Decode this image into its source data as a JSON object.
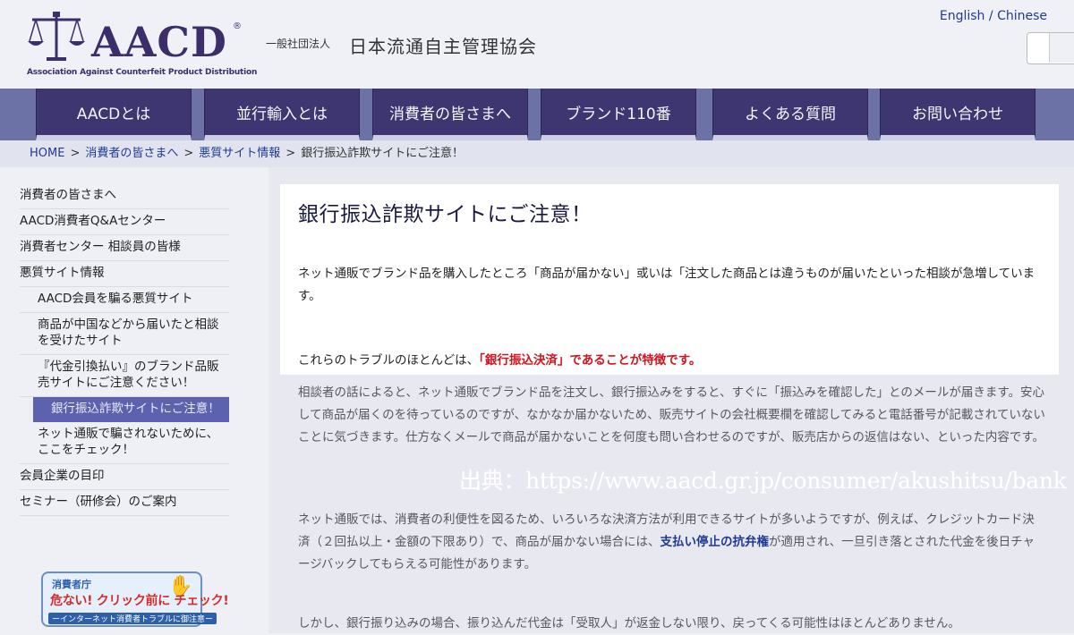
{
  "header": {
    "logo_text": "AACD",
    "logo_reg": "®",
    "logo_subtitle": "Association Against Counterfeit Product Distribution",
    "org_prefix": "一般社団法人",
    "org_name": "日本流通自主管理協会",
    "lang_english": "English",
    "lang_sep": "/",
    "lang_chinese": "Chinese",
    "search_placeholder": ""
  },
  "nav": {
    "items": [
      {
        "label": "AACDとは"
      },
      {
        "label": "並行輸入とは"
      },
      {
        "label": "消費者の皆さまへ"
      },
      {
        "label": "ブランド110番"
      },
      {
        "label": "よくある質問"
      },
      {
        "label": "お問い合わせ"
      }
    ]
  },
  "breadcrumb": {
    "home": "HOME",
    "arrow": ">",
    "level1": "消費者の皆さまへ",
    "level2": "悪質サイト情報",
    "current": "銀行振込詐欺サイトにご注意！"
  },
  "sidebar": {
    "items": [
      {
        "label": "消費者の皆さまへ"
      },
      {
        "label": "AACD消費者Q&Aセンター"
      },
      {
        "label": "消費者センター 相談員の皆様"
      },
      {
        "label": "悪質サイト情報"
      },
      {
        "label": "AACD会員を騙る悪質サイト"
      },
      {
        "label": "商品が中国などから届いたと相談を受けたサイト"
      },
      {
        "label": "『代金引換払い』のブランド品販売サイトにご注意ください！"
      },
      {
        "label": "銀行振込詐欺サイトにご注意！"
      },
      {
        "label": "ネット通販で騙されないために、ここをチェック！"
      },
      {
        "label": "会員企業の目印"
      },
      {
        "label": "セミナー（研修会）のご案内"
      }
    ],
    "banner": {
      "line1": "消費者庁",
      "line2": "危ない! クリック前に チェック!",
      "line3": "ーインターネット消費者トラブルに御注意ー"
    }
  },
  "main": {
    "title": "銀行振込詐欺サイトにご注意！",
    "intro": "ネット通販でブランド品を購入したところ「商品が届かない」或いは「注文した商品とは違うものが届いたといった相談が急増しています。",
    "feature_prefix": "これらのトラブルのほとんどは、",
    "feature_red": "「銀行振込決済」であることが特徴です。",
    "p1": "相談者の話によると、ネット通販でブランド品を注文し、銀行振込みをすると、すぐに「振込みを確認した」とのメールが届きます。安心して商品が届くのを待っているのですが、なかなか届かないため、販売サイトの会社概要欄を確認してみると電話番号が記載されていないことに気づきます。仕方なくメールで商品が届かないことを何度も問い合わせるのですが、販売店からの返信はない、といった内容です。",
    "p2_prefix": "ネット通販では、消費者の利便性を図るため、いろいろな決済方法が利用できるサイトが多いようですが、例えば、クレジットカード決済（２回払以上・金額の下限あり）で、商品が届かない場合には、",
    "p2_link": "支払い停止の抗弁権",
    "p2_suffix": "が適用され、一旦引き落とされた代金を後日チャージバックしてもらえる可能性があります。",
    "p3": "しかし、銀行振り込みの場合、振り込んだ代金は「受取人」が返金しない限り、戻ってくる可能性はほとんどありません。",
    "source_caption": "出典：https://www.aacd.gr.jp/consumer/akushitsu/bank"
  },
  "colors": {
    "nav_bg": "#3e3670",
    "accent_red": "#d0141f",
    "link_blue": "#1f3a93",
    "active_sidebar": "#5c62ae"
  }
}
